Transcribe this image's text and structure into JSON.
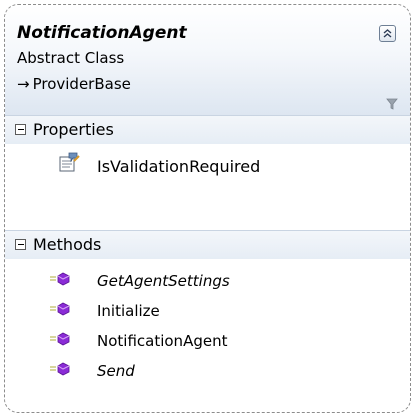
{
  "class_box": {
    "name": "NotificationAgent",
    "stereotype": "Abstract Class",
    "base_arrow": "→",
    "base_class": "ProviderBase"
  },
  "sections": {
    "properties": {
      "label": "Properties",
      "items": [
        {
          "name": "IsValidationRequired",
          "italic": false,
          "icon": "property-icon"
        }
      ]
    },
    "methods": {
      "label": "Methods",
      "items": [
        {
          "name": "GetAgentSettings",
          "italic": true,
          "icon": "method-icon"
        },
        {
          "name": "Initialize",
          "italic": false,
          "icon": "method-icon"
        },
        {
          "name": "NotificationAgent",
          "italic": false,
          "icon": "method-icon"
        },
        {
          "name": "Send",
          "italic": true,
          "icon": "method-icon"
        }
      ]
    }
  },
  "colors": {
    "header_gradient_end": "#dde6f1",
    "border": "#8c8c8c",
    "method_icon": "#8a2bd6"
  }
}
